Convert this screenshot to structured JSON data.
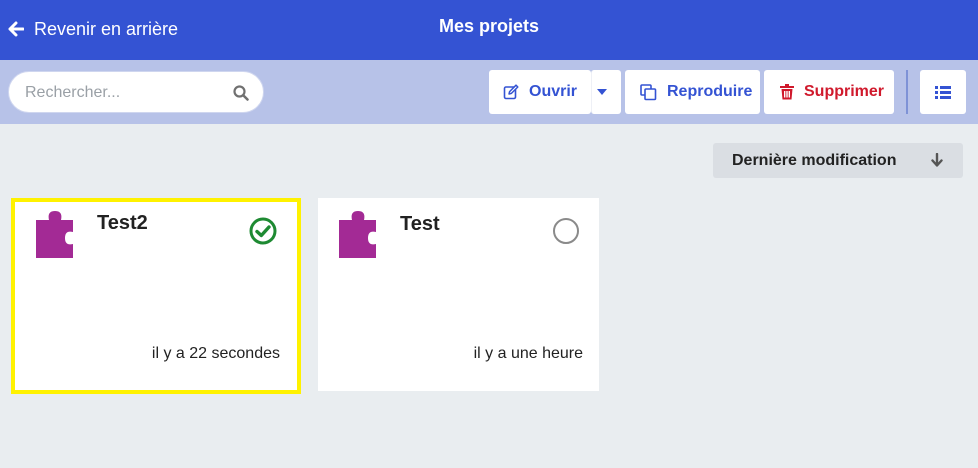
{
  "header": {
    "back_label": "Revenir en arrière",
    "title": "Mes projets"
  },
  "toolbar": {
    "search_placeholder": "Rechercher...",
    "open_label": "Ouvrir",
    "duplicate_label": "Reproduire",
    "delete_label": "Supprimer"
  },
  "sort": {
    "label": "Dernière modification"
  },
  "projects": [
    {
      "name": "Test2",
      "modified": "il y a 22 secondes",
      "selected": true
    },
    {
      "name": "Test",
      "modified": "il y a une heure",
      "selected": false
    }
  ],
  "colors": {
    "header_bg": "#3453d3",
    "toolbar_bg": "#b7c2e8",
    "accent": "#3453d3",
    "danger": "#d0192c",
    "puzzle": "#a32a95",
    "check": "#1e8a32",
    "selection": "#fff200"
  }
}
